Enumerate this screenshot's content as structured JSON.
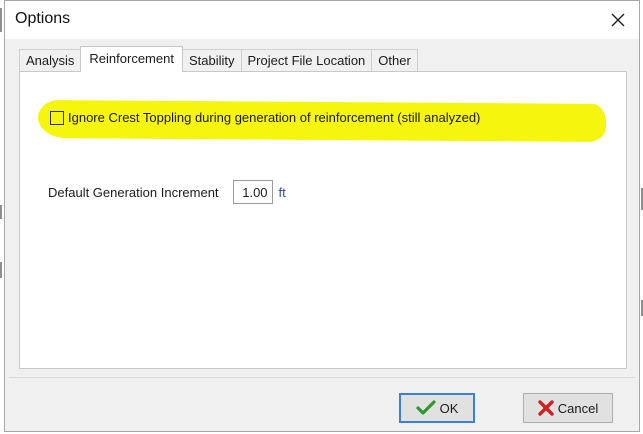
{
  "window": {
    "title": "Options",
    "close_glyph": "✕"
  },
  "tabs": [
    {
      "label": "Analysis",
      "active": false
    },
    {
      "label": "Reinforcement",
      "active": true
    },
    {
      "label": "Stability",
      "active": false
    },
    {
      "label": "Project File Location",
      "active": false
    },
    {
      "label": "Other",
      "active": false
    }
  ],
  "reinforcement": {
    "ignore_crest_toppling": {
      "label": "Ignore Crest Toppling during generation of reinforcement (still analyzed)",
      "checked": false,
      "highlight_color": "#f4f400"
    },
    "default_generation_increment": {
      "label": "Default Generation Increment",
      "value": "1.00",
      "unit": "ft"
    }
  },
  "buttons": {
    "ok": {
      "label": "OK",
      "icon": "checkmark-icon",
      "icon_color": "#2e9a2e"
    },
    "cancel": {
      "label": "Cancel",
      "icon": "x-mark-icon",
      "icon_color": "#cc2222"
    }
  },
  "colors": {
    "dialog_bg": "#f0f0f0",
    "unit_text": "#2a4bb4",
    "default_button_border": "#3c7fd8"
  }
}
